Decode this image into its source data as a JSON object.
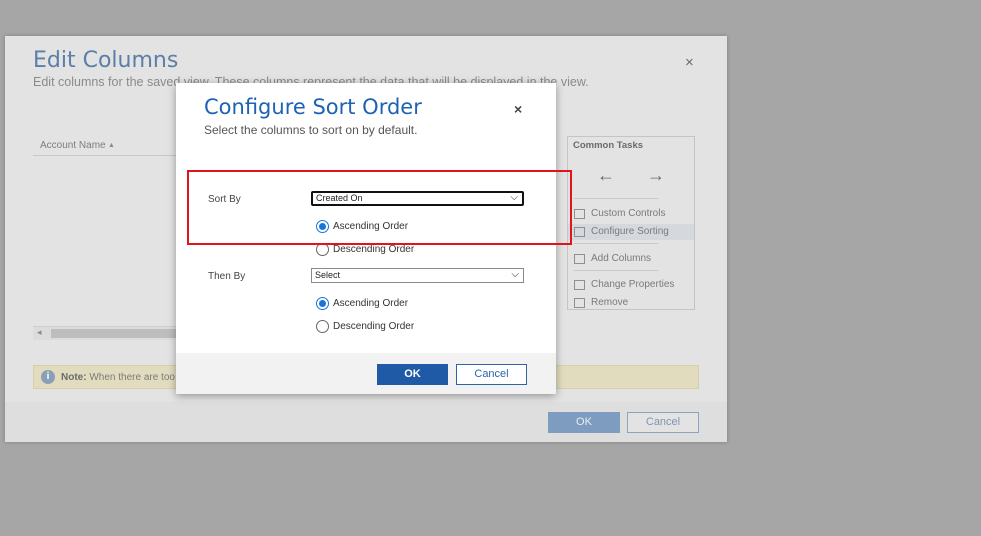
{
  "outer_dialog": {
    "title": "Edit Columns",
    "subtitle": "Edit columns for the saved view. These columns represent the data that will be displayed in the view.",
    "close_glyph": "×",
    "grid": {
      "column_header": "Account Name",
      "sort_glyph": "▲",
      "scroll_left_glyph": "◂"
    },
    "note": {
      "icon": "i",
      "label": "Note:",
      "text": "When there are too"
    },
    "common_tasks": {
      "title": "Common Tasks",
      "left_arrow": "←",
      "right_arrow": "→",
      "items": [
        "Custom Controls",
        "Configure Sorting",
        "Add Columns",
        "Change Properties",
        "Remove"
      ]
    },
    "ok_label": "OK",
    "cancel_label": "Cancel"
  },
  "sort_dialog": {
    "title": "Configure Sort Order",
    "subtitle": "Select the columns to sort on by default.",
    "close_glyph": "×",
    "sort_by": {
      "label": "Sort By",
      "value": "Created On",
      "ascending": "Ascending Order",
      "descending": "Descending Order",
      "selected": "ascending"
    },
    "then_by": {
      "label": "Then By",
      "value": "Select",
      "ascending": "Ascending Order",
      "descending": "Descending Order",
      "selected": "ascending"
    },
    "ok_label": "OK",
    "cancel_label": "Cancel"
  },
  "colors": {
    "accent": "#1f5aa6",
    "title": "#1e62b4",
    "highlight": "#e1141b",
    "radio_selected": "#1a73d9"
  },
  "icons": {
    "chevron": "chevron-down-icon",
    "close": "close-icon",
    "info": "info-icon"
  }
}
